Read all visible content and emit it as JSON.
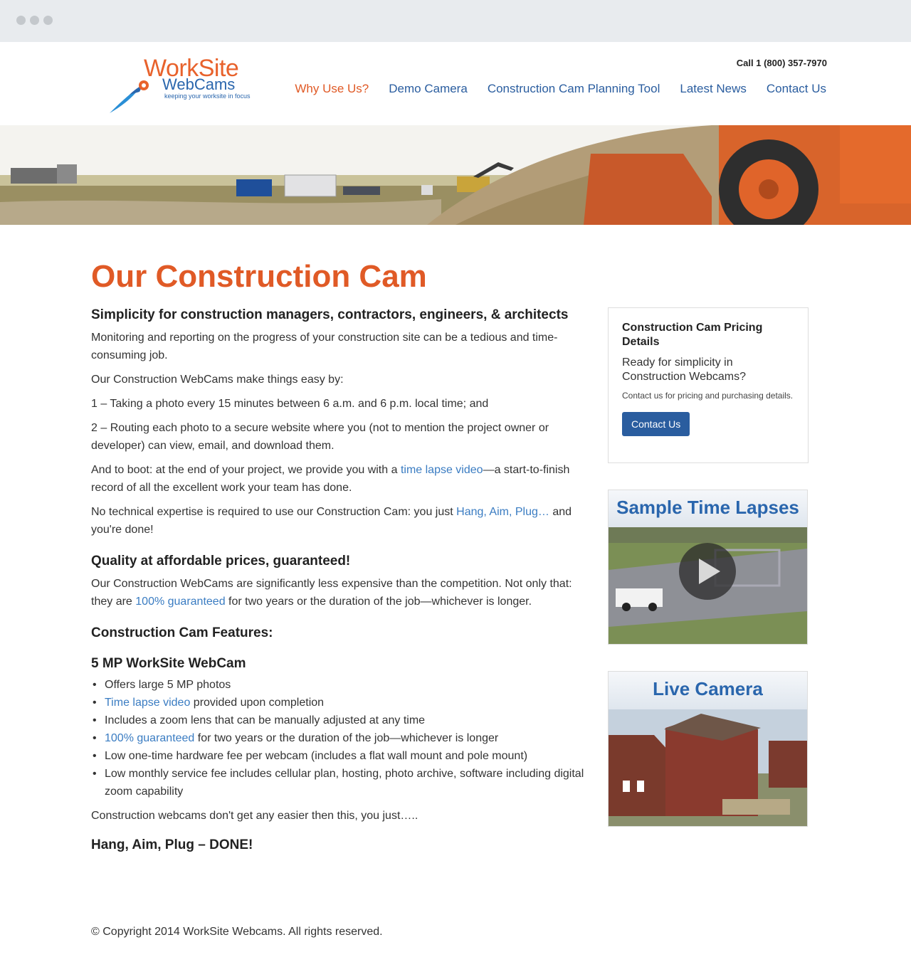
{
  "logo": {
    "line1": "WorkSite",
    "line2": "WebCams",
    "tagline": "keeping your worksite in focus"
  },
  "header": {
    "phone": "Call 1 (800) 357-7970",
    "nav": [
      "Why Use Us?",
      "Demo Camera",
      "Construction Cam Planning Tool",
      "Latest News",
      "Contact Us"
    ]
  },
  "main": {
    "title": "Our Construction Cam",
    "h_simplicity": "Simplicity for construction managers, contractors, engineers, & architects",
    "p1": "Monitoring and reporting on the progress of your construction site can be a tedious and time-consuming job.",
    "p2": "Our Construction WebCams make things easy by:",
    "p3": "1 – Taking a photo every 15 minutes between 6 a.m. and 6 p.m. local time; and",
    "p4": "2 – Routing each photo to a secure website where you (not to mention the project owner or developer) can view, email, and download them.",
    "p5_pre": "And to boot: at the end of your project, we provide you with a ",
    "p5_link": "time lapse video",
    "p5_post": "—a start-to-finish record of all the excellent work your team has done.",
    "p6_pre": "No technical expertise is required to use our Construction Cam: you just ",
    "p6_link": "Hang, Aim, Plug…",
    "p6_post": " and you're done!",
    "h_quality": "Quality at affordable prices, guaranteed!",
    "p7_pre": "Our Construction WebCams are significantly less expensive than the competition. Not only that: they are ",
    "p7_link": "100% guaranteed",
    "p7_post": " for two years or the duration of the job—whichever is longer.",
    "h_features": "Construction Cam Features:",
    "h_product": "5 MP WorkSite WebCam",
    "features": {
      "f1": "Offers large 5 MP photos",
      "f2_link": "Time lapse video",
      "f2_post": " provided upon completion",
      "f3": "Includes a zoom lens that can be manually adjusted at any time",
      "f4_link": "100% guaranteed",
      "f4_post": " for two years or the duration of the job—whichever is longer",
      "f5": "Low one-time hardware fee per webcam (includes a flat wall mount and pole mount)",
      "f6": "Low monthly service fee includes cellular plan, hosting, photo archive, software including digital zoom capability"
    },
    "p8": "Construction webcams don't get any easier then this, you just…..",
    "h_done": "Hang, Aim, Plug – DONE!"
  },
  "sidebar": {
    "pricing_title": "Construction Cam Pricing Details",
    "pricing_sub": "Ready for simplicity in Construction Webcams?",
    "pricing_small": "Contact us for pricing and purchasing details.",
    "pricing_button": "Contact Us",
    "timelapse_title": "Sample Time Lapses",
    "live_title": "Live Camera"
  },
  "footer": {
    "copyright": "© Copyright 2014 WorkSite Webcams. All rights reserved."
  },
  "colors": {
    "accent_orange": "#e05a26",
    "brand_blue": "#2a5d9f",
    "link_blue": "#3a7cc2"
  }
}
